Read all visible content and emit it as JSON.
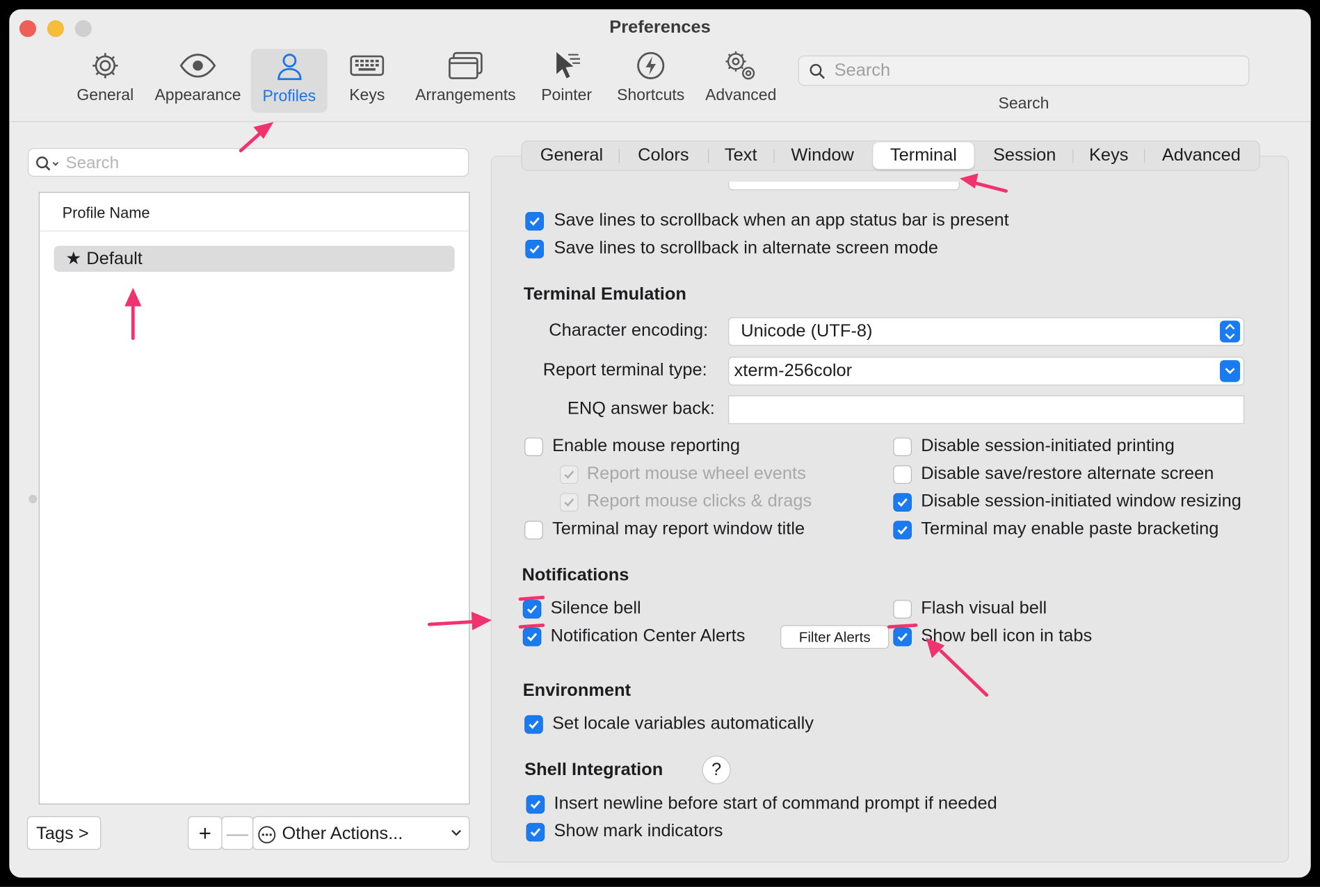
{
  "window": {
    "title": "Preferences"
  },
  "toolbar": {
    "items": [
      {
        "label": "General",
        "icon": "gear-icon"
      },
      {
        "label": "Appearance",
        "icon": "eye-icon"
      },
      {
        "label": "Profiles",
        "icon": "person-icon",
        "selected": true
      },
      {
        "label": "Keys",
        "icon": "keyboard-icon"
      },
      {
        "label": "Arrangements",
        "icon": "windows-icon"
      },
      {
        "label": "Pointer",
        "icon": "pointer-icon"
      },
      {
        "label": "Shortcuts",
        "icon": "lightning-icon"
      },
      {
        "label": "Advanced",
        "icon": "gears-icon"
      }
    ],
    "search_placeholder": "Search",
    "search_label": "Search"
  },
  "profiles": {
    "search_placeholder": "Search",
    "column_header": "Profile Name",
    "rows": [
      {
        "name": "★ Default",
        "selected": true
      }
    ],
    "tags_button": "Tags >",
    "add_button": "+",
    "remove_button": "—",
    "other_actions": "Other Actions..."
  },
  "tabs": [
    "General",
    "Colors",
    "Text",
    "Window",
    "Terminal",
    "Session",
    "Keys",
    "Advanced"
  ],
  "selected_tab": "Terminal",
  "scrollback": {
    "save_status_bar": {
      "label": "Save lines to scrollback when an app status bar is present",
      "checked": true
    },
    "save_alternate": {
      "label": "Save lines to scrollback in alternate screen mode",
      "checked": true
    }
  },
  "emulation": {
    "heading": "Terminal Emulation",
    "encoding_label": "Character encoding:",
    "encoding_value": "Unicode (UTF-8)",
    "term_type_label": "Report terminal type:",
    "term_type_value": "xterm-256color",
    "enq_label": "ENQ answer back:",
    "enq_value": "",
    "mouse_reporting": {
      "label": "Enable mouse reporting",
      "checked": false
    },
    "mouse_wheel": {
      "label": "Report mouse wheel events",
      "checked": true,
      "disabled": true
    },
    "mouse_clicks": {
      "label": "Report mouse clicks & drags",
      "checked": true,
      "disabled": true
    },
    "report_title": {
      "label": "Terminal may report window title",
      "checked": false
    },
    "disable_printing": {
      "label": "Disable session-initiated printing",
      "checked": false
    },
    "disable_alt_screen": {
      "label": "Disable save/restore alternate screen",
      "checked": false
    },
    "disable_resizing": {
      "label": "Disable session-initiated window resizing",
      "checked": true
    },
    "paste_bracketing": {
      "label": "Terminal may enable paste bracketing",
      "checked": true
    }
  },
  "notifications": {
    "heading": "Notifications",
    "silence_bell": {
      "label": "Silence bell",
      "checked": true
    },
    "nc_alerts": {
      "label": "Notification Center Alerts",
      "checked": true
    },
    "filter_alerts": "Filter Alerts",
    "flash_bell": {
      "label": "Flash visual bell",
      "checked": false
    },
    "bell_icon": {
      "label": "Show bell icon in tabs",
      "checked": true
    }
  },
  "environment": {
    "heading": "Environment",
    "locale": {
      "label": "Set locale variables automatically",
      "checked": true
    }
  },
  "shell": {
    "heading": "Shell Integration",
    "help": "?",
    "insert_newline": {
      "label": "Insert newline before start of command prompt if needed",
      "checked": true
    },
    "mark_indicators": {
      "label": "Show mark indicators",
      "checked": true
    }
  },
  "colors": {
    "accent": "#1a7bf0",
    "annotation": "#f0326e"
  }
}
